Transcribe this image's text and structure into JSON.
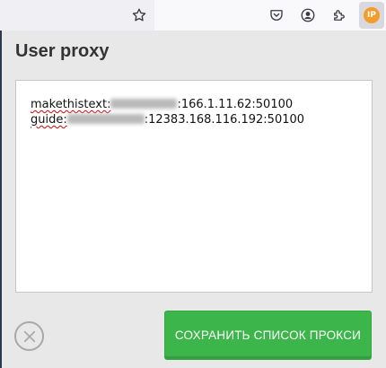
{
  "browser_toolbar": {
    "icons": [
      "star-icon",
      "pocket-icon",
      "account-icon",
      "extensions-icon",
      "proxy-extension-icon"
    ],
    "extension_logo_text": "IP"
  },
  "popup": {
    "title": "User proxy",
    "proxy_lines": [
      {
        "prefix": "makethistext:",
        "suffix": ":166.1.11.62:50100"
      },
      {
        "prefix": "guide:",
        "suffix": ":12383.168.116.192:50100"
      }
    ],
    "save_button_label": "СОХРАНИТЬ СПИСОК ПРОКСИ"
  },
  "colors": {
    "save_button": "#3cb54a",
    "background": "#e8e8e8",
    "extension_accent": "#f39c2a"
  }
}
